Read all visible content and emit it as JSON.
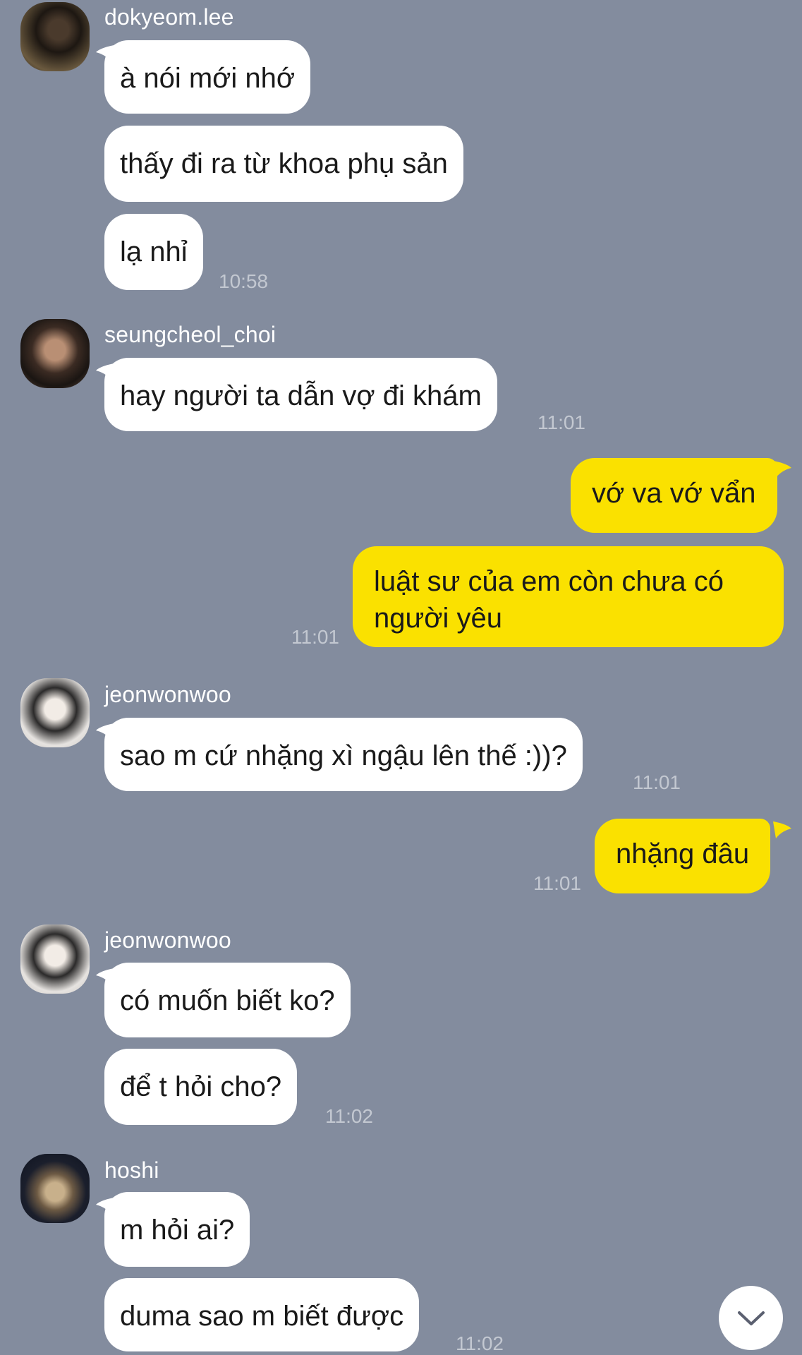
{
  "colors": {
    "background": "#838C9E",
    "incoming_bubble": "#FFFFFF",
    "outgoing_bubble": "#FAE100",
    "timestamp": "#C3C8D1"
  },
  "chat": {
    "groups": [
      {
        "sender": "dokyeom.lee",
        "avatar": "profile-photo",
        "messages": [
          {
            "text": "à nói mới nhớ"
          },
          {
            "text": "thấy đi ra từ khoa phụ sản"
          },
          {
            "text": "lạ nhỉ"
          }
        ],
        "time": "10:58"
      },
      {
        "sender": "seungcheol_choi",
        "avatar": "profile-photo",
        "messages": [
          {
            "text": "hay người ta dẫn vợ đi khám"
          }
        ],
        "time": "11:01"
      },
      {
        "sender": "me",
        "messages": [
          {
            "text": "vớ va vớ vẩn"
          },
          {
            "text": "luật sư của em còn chưa có người yêu"
          }
        ],
        "time": "11:01"
      },
      {
        "sender": "jeonwonwoo",
        "avatar": "profile-photo",
        "messages": [
          {
            "text": "sao m cứ nhặng xì ngậu lên thế :))?"
          }
        ],
        "time": "11:01"
      },
      {
        "sender": "me",
        "messages": [
          {
            "text": "nhặng đâu"
          }
        ],
        "time": "11:01"
      },
      {
        "sender": "jeonwonwoo",
        "avatar": "profile-photo",
        "messages": [
          {
            "text": "có muốn biết ko?"
          },
          {
            "text": "để t hỏi cho?"
          }
        ],
        "time": "11:02"
      },
      {
        "sender": "hoshi",
        "avatar": "profile-photo",
        "messages": [
          {
            "text": "m hỏi ai?"
          },
          {
            "text": "duma sao m biết được"
          }
        ],
        "time": "11:02"
      }
    ]
  },
  "controls": {
    "scroll_button_icon": "chevron-down-icon"
  }
}
